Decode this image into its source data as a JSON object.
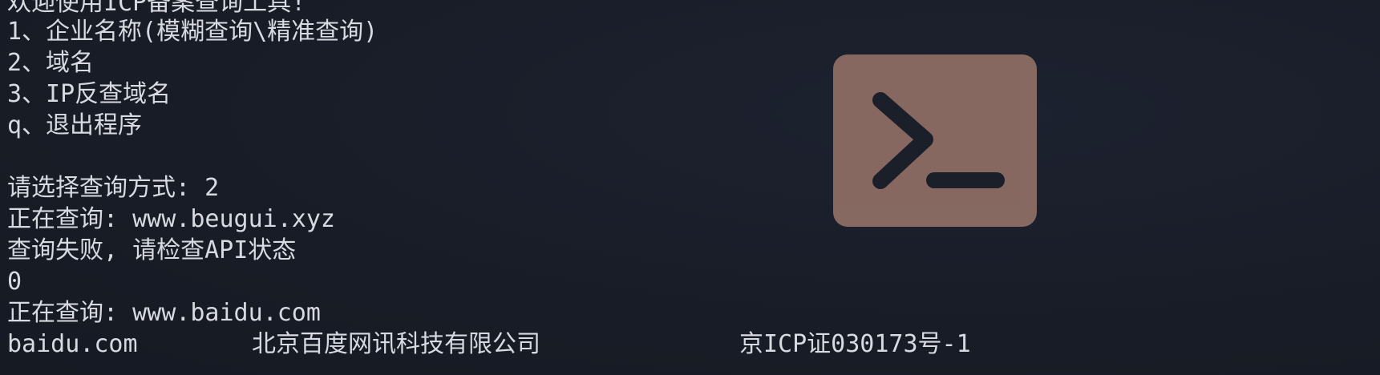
{
  "terminal": {
    "lines": {
      "cut_top": "欢迎使用ICP备案查询工具!",
      "menu_1": "1、企业名称(模糊查询\\精准查询)",
      "menu_2": "2、域名",
      "menu_3": "3、IP反查域名",
      "menu_q": "q、退出程序",
      "prompt": "请选择查询方式: 2",
      "querying_1": "正在查询: www.beugui.xyz",
      "fail": "查询失败, 请检查API状态",
      "zero": "0",
      "querying_2": "正在查询: www.baidu.com"
    },
    "result_row": {
      "domain": "baidu.com",
      "company": "北京百度网讯科技有限公司",
      "icp": "京ICP证030173号-1"
    }
  },
  "overlay": {
    "icon": "terminal-prompt-icon",
    "background_color": "#8a6b63",
    "glyph_color": "#1b1f2a"
  }
}
